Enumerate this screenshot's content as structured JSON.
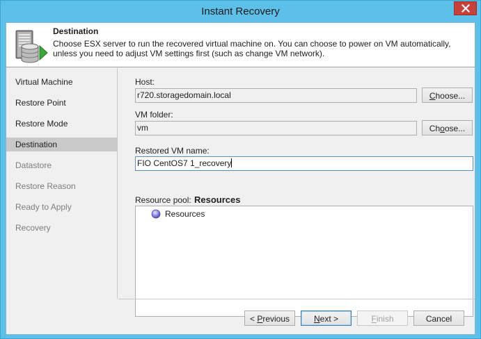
{
  "window": {
    "title": "Instant Recovery"
  },
  "header": {
    "title": "Destination",
    "description": "Choose ESX server to run the recovered virtual machine on. You can choose to power on VM automatically, unless you need to adjust VM settings first (such as change VM network).",
    "icon": "server-database-icon"
  },
  "nav": {
    "items": [
      {
        "label": "Virtual Machine",
        "state": "enabled"
      },
      {
        "label": "Restore Point",
        "state": "enabled"
      },
      {
        "label": "Restore Mode",
        "state": "enabled"
      },
      {
        "label": "Destination",
        "state": "selected"
      },
      {
        "label": "Datastore",
        "state": "disabled"
      },
      {
        "label": "Restore Reason",
        "state": "disabled"
      },
      {
        "label": "Ready to Apply",
        "state": "disabled"
      },
      {
        "label": "Recovery",
        "state": "disabled"
      }
    ]
  },
  "form": {
    "host_label": "Host:",
    "host_value": "r720.storagedomain.local",
    "host_choose": "Choose...",
    "folder_label": "VM folder:",
    "folder_value": "vm",
    "folder_choose": "Choose...",
    "name_label": "Restored VM name:",
    "name_value": "FIO CentOS7 1_recovery",
    "pool_label": "Resource pool:",
    "pool_value": "Resources",
    "pool_tree": [
      {
        "label": "Resources",
        "icon": "resource-pool-icon"
      }
    ]
  },
  "footer": {
    "previous": "< Previous",
    "next": "Next >",
    "finish": "Finish",
    "cancel": "Cancel"
  },
  "colors": {
    "titlebar": "#5dc0e8",
    "close": "#c7403a",
    "selected_nav": "#c9c9c9"
  }
}
